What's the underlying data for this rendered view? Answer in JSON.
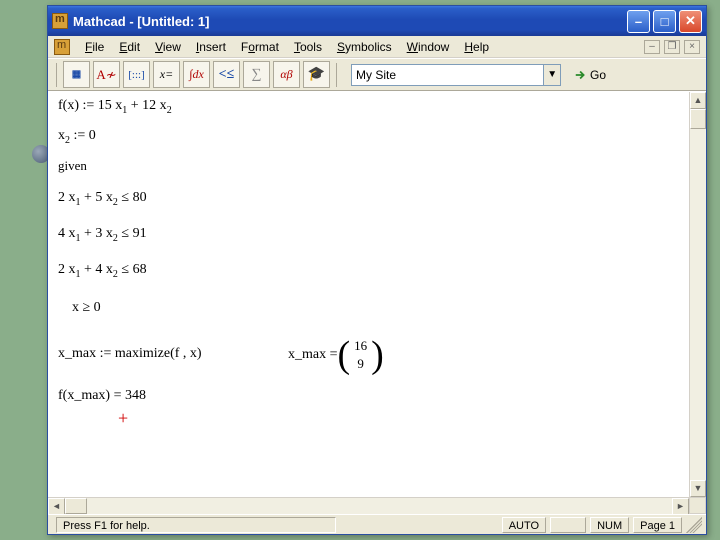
{
  "title": "Mathcad - [Untitled: 1]",
  "menu": {
    "file": "File",
    "edit": "Edit",
    "view": "View",
    "insert": "Insert",
    "format": "Format",
    "tools": "Tools",
    "symbolics": "Symbolics",
    "window": "Window",
    "help": "Help"
  },
  "toolbar": {
    "site_value": "My Site",
    "go_label": "Go",
    "btn_calc": "▦",
    "btn_graph": "A≁",
    "btn_matrix": "[:::]",
    "btn_eval": "x=",
    "btn_calc2": "∫dx",
    "btn_bool": "<≤",
    "btn_prog": "∑",
    "btn_greek": "αβ",
    "btn_sym": "🎓"
  },
  "math": {
    "l1a": "f(x) := 15 x",
    "l1s1": "1",
    "l1b": " + 12 x",
    "l1s2": "2",
    "l2a": "x",
    "l2s": "2",
    "l2b": " := 0",
    "l3": "given",
    "c1a": "2 x",
    "c1s1": "1",
    "c1b": " + 5 x",
    "c1s2": "2",
    "c1c": " ≤ 80",
    "c2a": "4 x",
    "c2s1": "1",
    "c2b": " + 3 x",
    "c2s2": "2",
    "c2c": " ≤ 91",
    "c3a": "2 x",
    "c3s1": "1",
    "c3b": " + 4 x",
    "c3s2": "2",
    "c3c": " ≤ 68",
    "c4": "x ≥ 0",
    "r1": "x_max := maximize(f , x)",
    "r2a": "x_max = ",
    "r2v1": "16",
    "r2v2": "9",
    "r3": "f(x_max) = 348",
    "cursor": "+"
  },
  "status": {
    "msg": "Press F1 for help.",
    "auto": "AUTO",
    "num": "NUM",
    "page": "Page 1"
  },
  "sb": {
    "up": "▲",
    "down": "▼",
    "left": "◄",
    "right": "►",
    "drop": "▼"
  },
  "mdi": {
    "min": "–",
    "restore": "❐",
    "close": "×"
  }
}
